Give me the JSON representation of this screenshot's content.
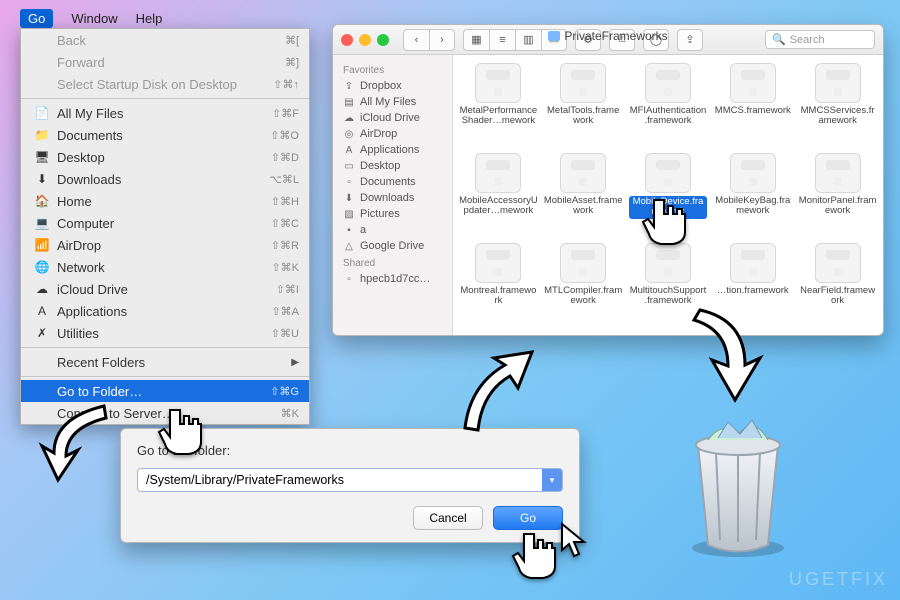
{
  "menubar": {
    "items": [
      "Go",
      "Window",
      "Help"
    ],
    "selected": "Go"
  },
  "go_menu": {
    "disabled": [
      {
        "label": "Back",
        "shortcut": "⌘["
      },
      {
        "label": "Forward",
        "shortcut": "⌘]"
      },
      {
        "label": "Select Startup Disk on Desktop",
        "shortcut": "⇧⌘↑"
      }
    ],
    "places": [
      {
        "icon": "📄",
        "label": "All My Files",
        "shortcut": "⇧⌘F"
      },
      {
        "icon": "📁",
        "label": "Documents",
        "shortcut": "⇧⌘O"
      },
      {
        "icon": "🖥",
        "label": "Desktop",
        "shortcut": "⇧⌘D"
      },
      {
        "icon": "⬇",
        "label": "Downloads",
        "shortcut": "⌥⌘L"
      },
      {
        "icon": "🏠",
        "label": "Home",
        "shortcut": "⇧⌘H"
      },
      {
        "icon": "💻",
        "label": "Computer",
        "shortcut": "⇧⌘C"
      },
      {
        "icon": "📶",
        "label": "AirDrop",
        "shortcut": "⇧⌘R"
      },
      {
        "icon": "🌐",
        "label": "Network",
        "shortcut": "⇧⌘K"
      },
      {
        "icon": "☁",
        "label": "iCloud Drive",
        "shortcut": "⇧⌘I"
      },
      {
        "icon": "A",
        "label": "Applications",
        "shortcut": "⇧⌘A"
      },
      {
        "icon": "✗",
        "label": "Utilities",
        "shortcut": "⇧⌘U"
      }
    ],
    "recent": {
      "label": "Recent Folders",
      "arrow": "▶"
    },
    "gotofolder": {
      "label": "Go to Folder…",
      "shortcut": "⇧⌘G"
    },
    "connect": {
      "label": "Connect to Server…",
      "shortcut": "⌘K"
    }
  },
  "finder": {
    "title": "PrivateFrameworks",
    "search_placeholder": "Search",
    "toolbar_icons": {
      "back": "‹",
      "fwd": "›",
      "icon": "▦",
      "list": "≡",
      "col": "▥",
      "gallery": "▭",
      "group": "⚙",
      "share": "⍐",
      "tags": "◯",
      "dropbox": "⇪"
    },
    "sidebar": {
      "favorites_hdr": "Favorites",
      "shared_hdr": "Shared",
      "favorites": [
        {
          "ic": "⇪",
          "label": "Dropbox"
        },
        {
          "ic": "▤",
          "label": "All My Files"
        },
        {
          "ic": "☁",
          "label": "iCloud Drive"
        },
        {
          "ic": "◎",
          "label": "AirDrop"
        },
        {
          "ic": "A",
          "label": "Applications"
        },
        {
          "ic": "▭",
          "label": "Desktop"
        },
        {
          "ic": "▫",
          "label": "Documents"
        },
        {
          "ic": "⬇",
          "label": "Downloads"
        },
        {
          "ic": "▧",
          "label": "Pictures"
        },
        {
          "ic": "▪",
          "label": "a"
        },
        {
          "ic": "△",
          "label": "Google Drive"
        }
      ],
      "shared": [
        {
          "ic": "▫",
          "label": "hpecb1d7cc…"
        }
      ]
    },
    "files": [
      "MetalPerformanceShader…mework",
      "MetalTools.framework",
      "MFIAuthentication.framework",
      "MMCS.framework",
      "MMCSServices.framework",
      "MobileAccessoryUpdater…mework",
      "MobileAsset.framework",
      "MobileDevice.framework",
      "MobileKeyBag.framework",
      "MonitorPanel.framework",
      "Montreal.framework",
      "MTLCompiler.framework",
      "MultitouchSupport.framework",
      "…tion.framework",
      "NearField.framework"
    ],
    "selected_index": 7
  },
  "gtf": {
    "title": "Go to the folder:",
    "path": "/System/Library/PrivateFrameworks",
    "cancel": "Cancel",
    "go": "Go"
  },
  "watermark": "UGETFIX"
}
